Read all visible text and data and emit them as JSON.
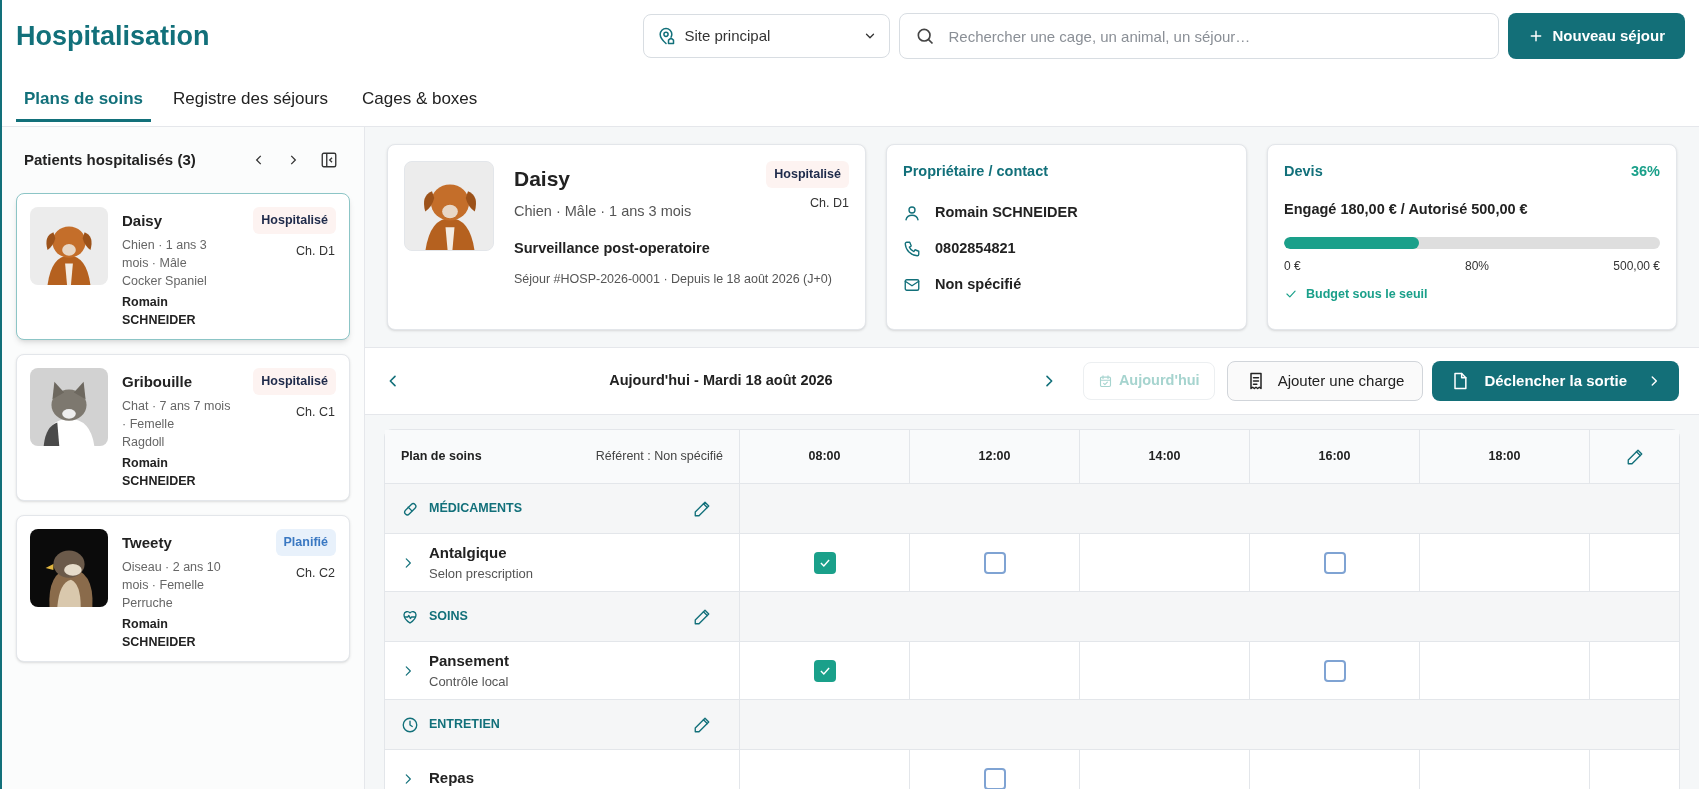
{
  "header": {
    "title": "Hospitalisation",
    "site_select": {
      "value": "Site principal"
    },
    "search": {
      "placeholder": "Rechercher une cage, un animal, un séjour…"
    },
    "new_button": "Nouveau séjour"
  },
  "tabs": [
    {
      "label": "Plans de soins",
      "selected": true
    },
    {
      "label": "Registre des séjours",
      "selected": false
    },
    {
      "label": "Cages & boxes",
      "selected": false
    }
  ],
  "sidebar": {
    "title": "Patients hospitalisés (3)",
    "patients": [
      {
        "name": "Daisy",
        "details": "Chien · 1 ans 3 mois · Mâle",
        "breed": "Cocker Spaniel",
        "owner": "Romain SCHNEIDER",
        "status": "Hospitalisé",
        "kind": "hospitalised",
        "cage": "Ch. D1",
        "selected": true
      },
      {
        "name": "Gribouille",
        "details": "Chat · 7 ans 7 mois · Femelle",
        "breed": "Ragdoll",
        "owner": "Romain SCHNEIDER",
        "status": "Hospitalisé",
        "kind": "hospitalised",
        "cage": "Ch. C1",
        "selected": false
      },
      {
        "name": "Tweety",
        "details": "Oiseau · 2 ans 10 mois · Femelle",
        "breed": "Perruche",
        "owner": "Romain SCHNEIDER",
        "status": "Planifié",
        "kind": "planned",
        "cage": "Ch. C2",
        "selected": false
      }
    ]
  },
  "patient_card": {
    "name": "Daisy",
    "details": "Chien · Mâle · 1 ans 3 mois",
    "status": "Hospitalisé",
    "cage": "Ch. D1",
    "reason": "Surveillance post-operatoire",
    "stay": "Séjour #HOSP-2026-0001 · Depuis le 18 août 2026 (J+0)"
  },
  "owner_card": {
    "title": "Propriétaire / contact",
    "items": [
      {
        "kind": "person",
        "text": "Romain SCHNEIDER"
      },
      {
        "kind": "phone",
        "text": "0802854821"
      },
      {
        "kind": "mail",
        "text": "Non spécifié"
      }
    ]
  },
  "quote_card": {
    "title": "Devis",
    "percent": "36%",
    "summary": "Engagé 180,00 € / Autorisé 500,00 €",
    "level": 0.36,
    "min": "0 €",
    "threshold": "80%",
    "max": "500,00 €",
    "status": "Budget sous le seuil"
  },
  "day_nav": {
    "date": "Aujourd'hui - Mardi 18 août 2026",
    "today_button": {
      "label": "Aujourd'hui",
      "disabled": true
    },
    "charge_button": "Ajouter une charge",
    "discharge_button": "Déclencher la sortie"
  },
  "care_plan": {
    "title": "Plan de soins",
    "referent": "Référent : Non spécifié",
    "times": [
      "08:00",
      "12:00",
      "14:00",
      "16:00",
      "18:00"
    ],
    "sections": [
      {
        "kind": "medication",
        "label": "MÉDICAMENTS",
        "items": [
          {
            "name": "Antalgique",
            "note": "Selon prescription",
            "cells": [
              {
                "kind": "checkbox",
                "checked": true
              },
              {
                "kind": "checkbox",
                "checked": false
              },
              {
                "kind": "empty"
              },
              {
                "kind": "checkbox",
                "checked": false
              },
              {
                "kind": "empty"
              }
            ]
          }
        ]
      },
      {
        "kind": "care",
        "label": "SOINS",
        "items": [
          {
            "name": "Pansement",
            "note": "Contrôle local",
            "cells": [
              {
                "kind": "checkbox",
                "checked": true
              },
              {
                "kind": "empty"
              },
              {
                "kind": "empty"
              },
              {
                "kind": "checkbox",
                "checked": false
              },
              {
                "kind": "empty"
              }
            ]
          }
        ]
      },
      {
        "kind": "upkeep",
        "label": "ENTRETIEN",
        "items": [
          {
            "name": "Repas",
            "cells": [
              {
                "kind": "empty"
              },
              {
                "kind": "checkbox",
                "checked": false
              },
              {
                "kind": "empty"
              },
              {
                "kind": "empty"
              },
              {
                "kind": "empty"
              }
            ]
          }
        ]
      }
    ]
  }
}
